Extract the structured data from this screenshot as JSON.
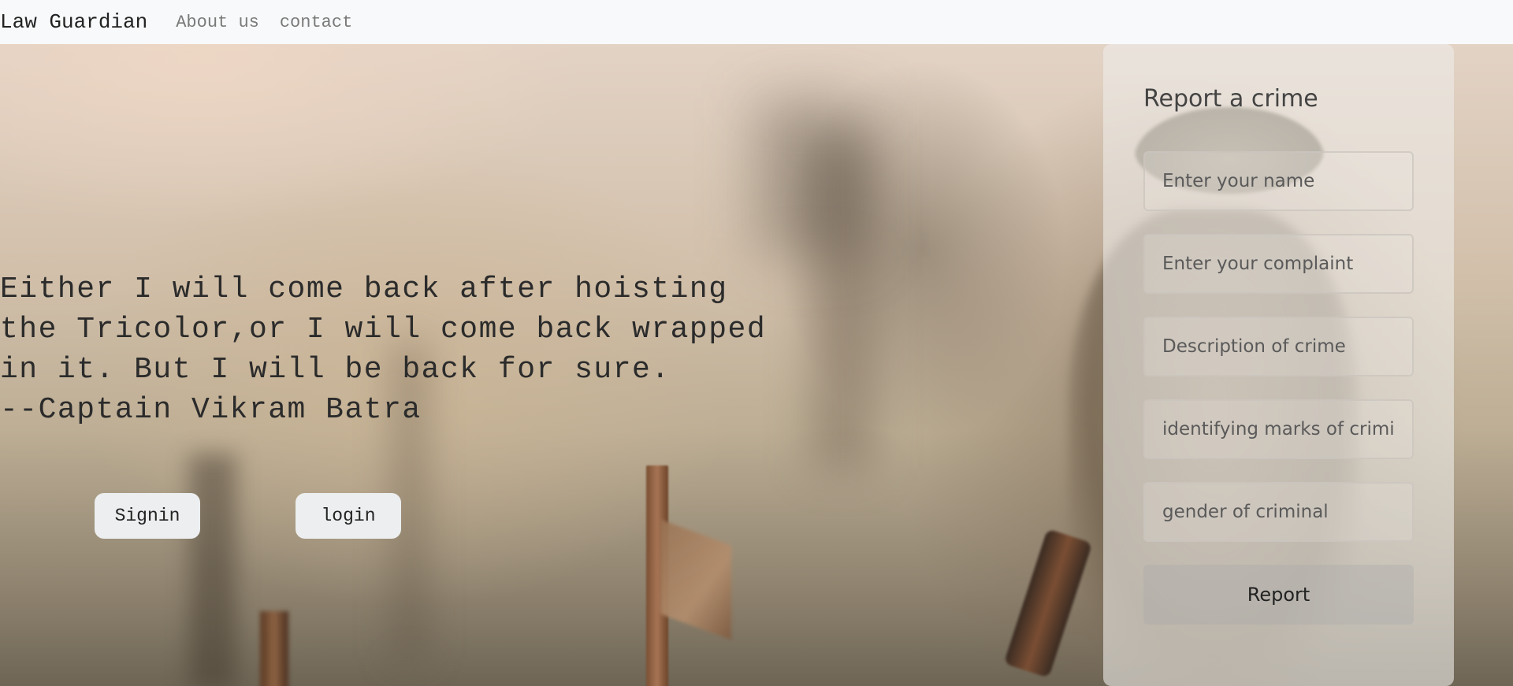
{
  "navbar": {
    "brand": "Law Guardian",
    "links": [
      {
        "label": "About us"
      },
      {
        "label": "contact"
      }
    ]
  },
  "hero": {
    "quote": "Either I will come back after hoisting\nthe Tricolor,or I will come back wrapped\nin it. But I will be back for sure.\n--Captain Vikram Batra",
    "buttons": {
      "signin": "Signin",
      "login": "login"
    }
  },
  "report_form": {
    "title": "Report a crime",
    "fields": [
      {
        "placeholder": "Enter your name",
        "value": ""
      },
      {
        "placeholder": "Enter your complaint",
        "value": ""
      },
      {
        "placeholder": "Description of crime",
        "value": ""
      },
      {
        "placeholder": "identifying marks of criminal",
        "value": ""
      },
      {
        "placeholder": "gender of criminal",
        "value": ""
      }
    ],
    "submit_label": "Report"
  }
}
